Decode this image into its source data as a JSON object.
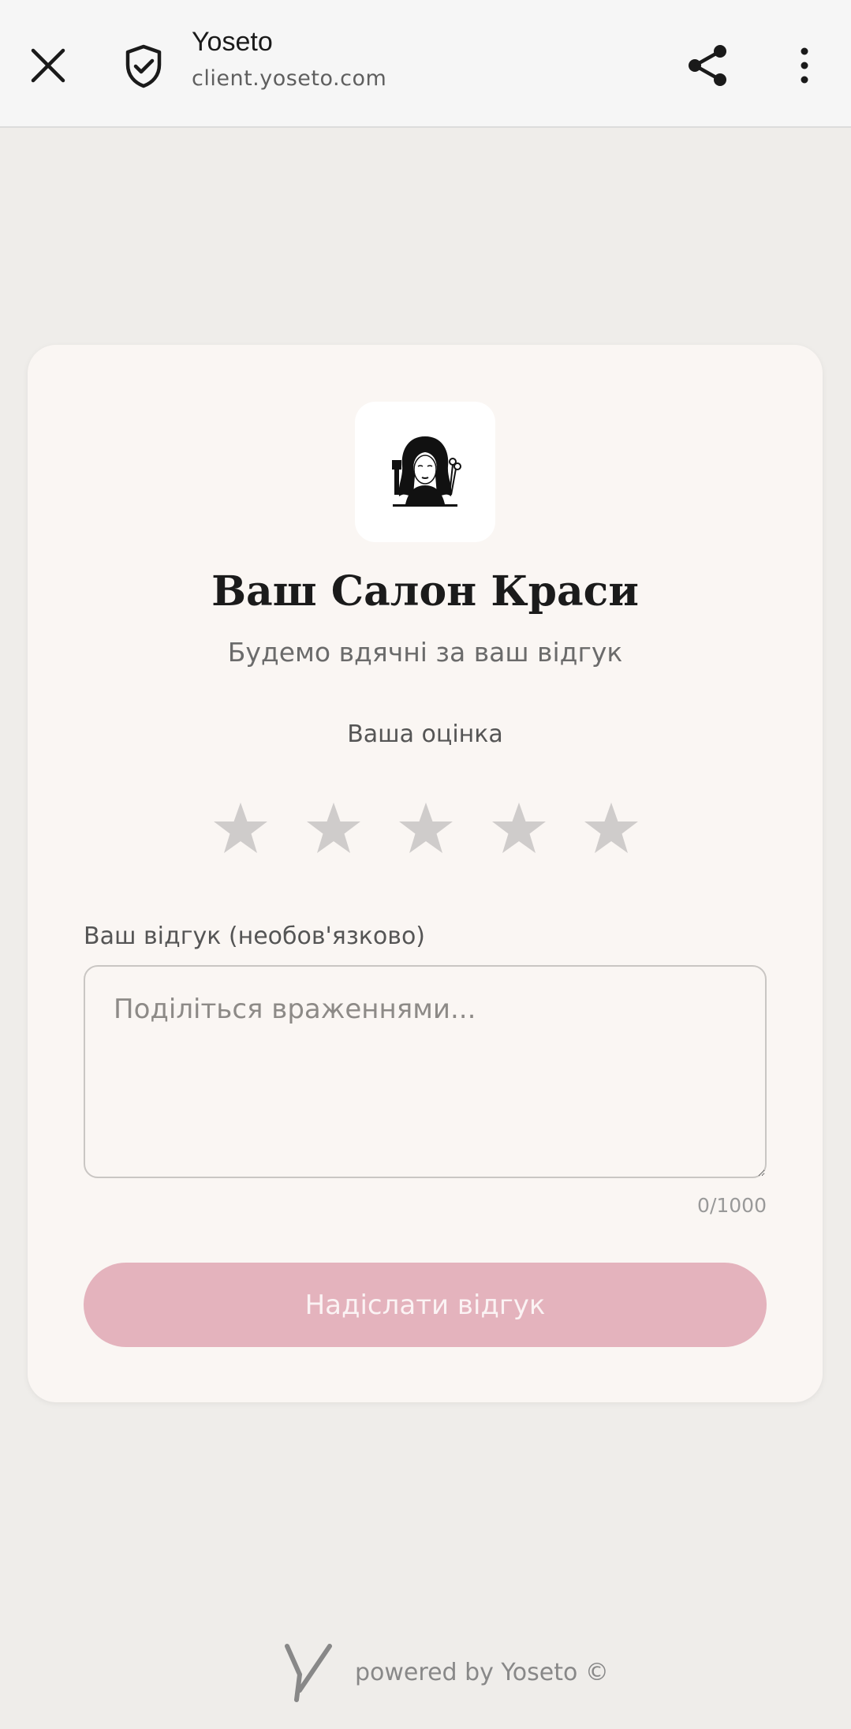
{
  "browser": {
    "title": "Yoseto",
    "url": "client.yoseto.com",
    "icons": {
      "close": "close-icon",
      "security": "shield-check-icon",
      "share": "share-icon",
      "menu": "more-vertical-icon"
    }
  },
  "card": {
    "logo_icon": "salon-woman-logo",
    "salon_name": "Ваш Салон Краси",
    "subtitle": "Будемо вдячні за ваш відгук",
    "rating_label": "Ваша оцінка",
    "rating": {
      "value": 0,
      "max": 5
    },
    "review_label": "Ваш відгук (необов'язково)",
    "review_value": "",
    "review_placeholder": "Поділіться враженнями...",
    "char_count": "0/1000",
    "submit_label": "Надіслати відгук"
  },
  "footer": {
    "powered_by": "powered by Yoseto ©"
  },
  "colors": {
    "page_bg": "#efedea",
    "card_bg": "#faf6f3",
    "star_inactive": "#cfcccb",
    "button_bg": "#e4b3bd",
    "button_text": "#fbf3f4"
  }
}
